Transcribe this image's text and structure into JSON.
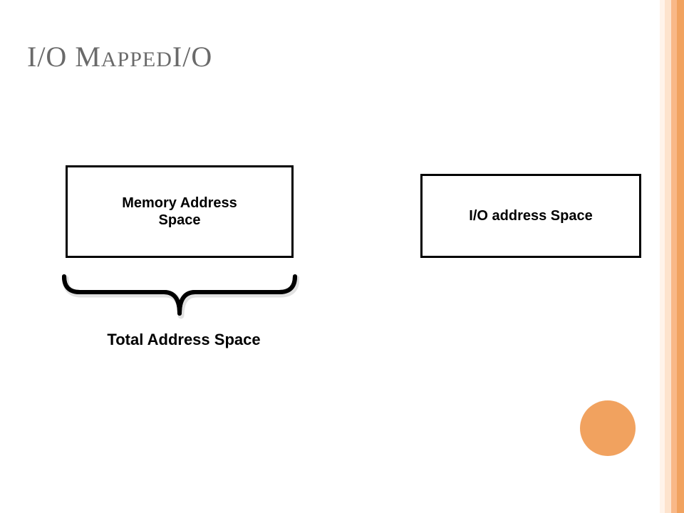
{
  "title": {
    "part1": "I/O M",
    "part_small": "APPED",
    "part2": "I/O"
  },
  "boxes": {
    "memory": {
      "label_line1": "Memory Address",
      "label_line2": "Space"
    },
    "io": {
      "label": "I/O  address Space"
    }
  },
  "brace_caption": "Total Address Space",
  "theme": {
    "accent_color": "#f1a25f"
  }
}
